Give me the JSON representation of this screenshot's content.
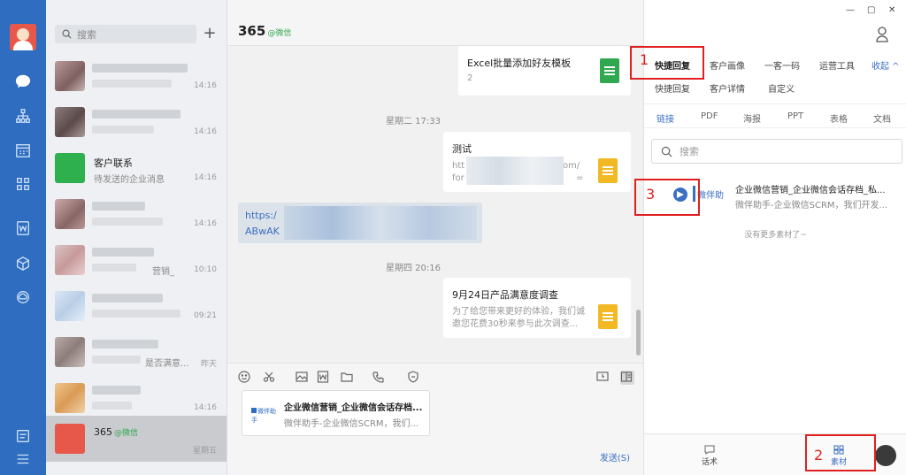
{
  "rail": {
    "icons": [
      "chat-icon",
      "org-chart-icon",
      "calendar-icon",
      "apps-grid-icon",
      "document-w-icon",
      "cube-icon",
      "cloud-icon",
      "note-icon",
      "menu-icon"
    ]
  },
  "contacts": {
    "search_placeholder": "搜索",
    "items": [
      {
        "time": "14:16"
      },
      {
        "time": "14:16"
      },
      {
        "name": "客户联系",
        "sub": "待发送的企业消息",
        "time": "14:16"
      },
      {
        "time": "14:16"
      },
      {
        "sub": "营销_",
        "time": "10:10"
      },
      {
        "time": "09:21"
      },
      {
        "sub": "是否满意...",
        "time": "昨天"
      },
      {
        "time": "14:16"
      },
      {
        "name": "365",
        "tag": "@微信",
        "time": "星期五"
      }
    ]
  },
  "chat": {
    "title": "365",
    "title_tag": "@微信",
    "messages": {
      "excel_title": "Excel批量添加好友模板",
      "excel_count": "2",
      "ts1": "星期二 17:33",
      "test_title": "测试",
      "test_l1": "htt",
      "test_l1b": "om/",
      "test_l2": "for",
      "test_l2b": "=",
      "link_l1": "https:/",
      "link_l2": "ABwAK",
      "ts2": "星期四 20:16",
      "survey_title": "9月24日产品满意度调查",
      "survey_d1": "为了给您带来更好的体验，我们诚",
      "survey_d2": "邀您花费30秒来参与此次调查..."
    },
    "draft": {
      "logo": "微伴助手",
      "title": "企业微信营销_企业微信会话存档...",
      "desc": "微伴助手-企业微信SCRM，我们..."
    },
    "send_label": "发送(S)"
  },
  "panel": {
    "tabs1": [
      "快捷回复",
      "客户画像",
      "一客一码",
      "运营工具"
    ],
    "collapse": "收起 ^",
    "tabs2": [
      "快捷回复",
      "客户详情",
      "自定义"
    ],
    "tabs3": [
      "链接",
      "PDF",
      "海报",
      "PPT",
      "表格",
      "文档"
    ],
    "search_placeholder": "搜索",
    "material": {
      "brand": "微伴助",
      "title": "企业微信营销_企业微信会话存档_私...",
      "desc": "微伴助手-企业微信SCRM，我们开发..."
    },
    "no_more": "没有更多素材了~",
    "bottom": {
      "script": "话术",
      "material": "素材"
    }
  },
  "annotations": {
    "n1": "1",
    "n2": "2",
    "n3": "3"
  },
  "colors": {
    "rail": "#2e6dbf",
    "accent": "#3a6fc2",
    "annotation": "#e02020"
  }
}
